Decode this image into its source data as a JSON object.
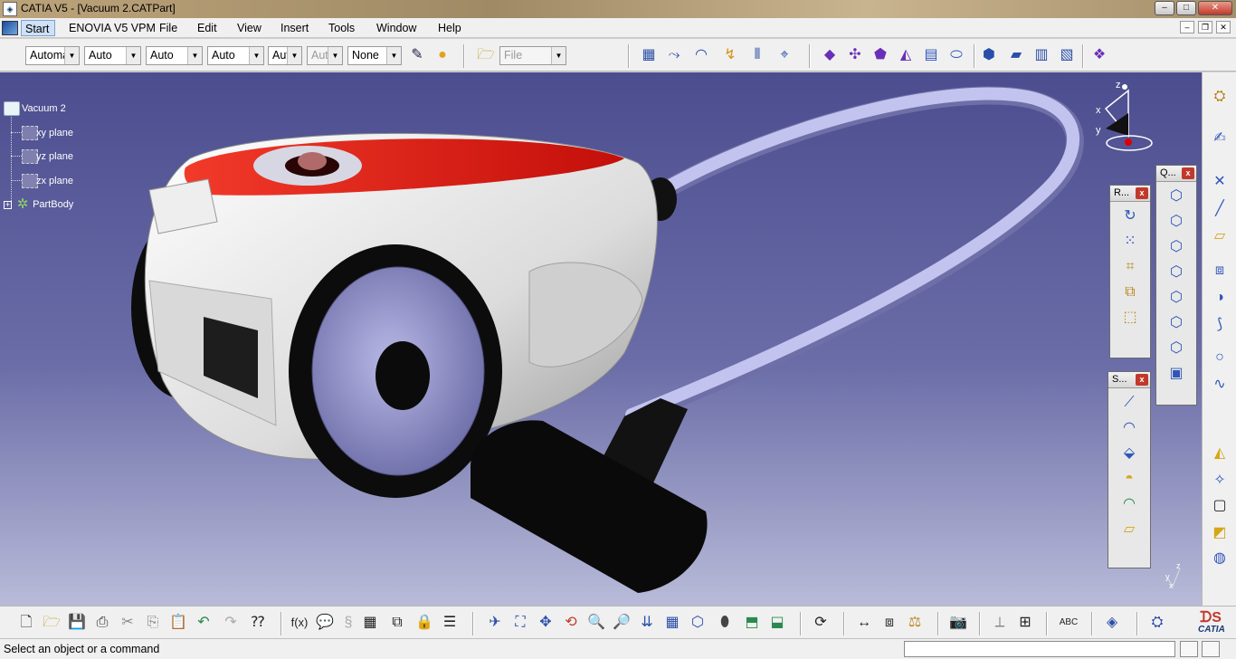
{
  "window": {
    "title": "CATIA V5 - [Vacuum 2.CATPart]"
  },
  "menu": {
    "items": [
      "Start",
      "ENOVIA V5 VPM",
      "File",
      "Edit",
      "View",
      "Insert",
      "Tools",
      "Window",
      "Help"
    ]
  },
  "toolbar": {
    "combos": [
      {
        "value": "Automa",
        "disabled": false
      },
      {
        "value": "Auto",
        "disabled": false
      },
      {
        "value": "Auto",
        "disabled": false
      },
      {
        "value": "Auto",
        "disabled": false
      },
      {
        "value": "Aut",
        "disabled": false
      },
      {
        "value": "Aut",
        "disabled": true
      },
      {
        "value": "None",
        "disabled": false
      }
    ],
    "file_combo": {
      "value": "File",
      "disabled": true
    }
  },
  "tree": {
    "root": "Vacuum 2",
    "planes": [
      "xy plane",
      "yz plane",
      "zx plane"
    ],
    "body": "PartBody"
  },
  "floating_toolbars": [
    {
      "title": "R...",
      "close": "x"
    },
    {
      "title": "S...",
      "close": "x"
    },
    {
      "title": "Q...",
      "close": "x"
    }
  ],
  "compass": {
    "x": "x",
    "y": "y",
    "z": "z"
  },
  "mini_axis": {
    "y": "y",
    "z": "z",
    "x": "x"
  },
  "brand": {
    "logo_text": "CATIA"
  },
  "status": {
    "message": "Select an object or a command"
  },
  "colors": {
    "viewport_top": "#4c4d8f",
    "viewport_bottom": "#b9bbd9",
    "body_red": "#d81810",
    "body_white": "#e9e9e9"
  }
}
